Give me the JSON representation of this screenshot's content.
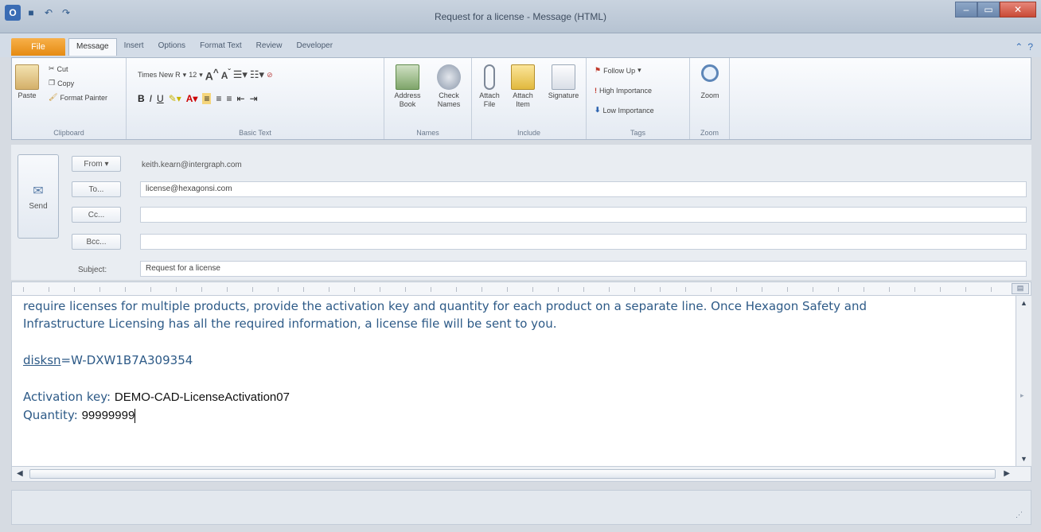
{
  "window": {
    "title": "Request for a license - Message (HTML)",
    "qat": [
      "save-icon",
      "undo-icon",
      "redo-icon"
    ],
    "controls": [
      "–",
      "▭",
      "✕"
    ]
  },
  "ribbon_tabs": {
    "file": "File",
    "tabs": [
      "Message",
      "Insert",
      "Options",
      "Format Text",
      "Review",
      "Developer"
    ],
    "active": "Message"
  },
  "ribbon": {
    "clipboard": {
      "paste": "Paste",
      "cut": "Cut",
      "copy": "Copy",
      "format_painter": "Format Painter",
      "label": "Clipboard"
    },
    "basic_text": {
      "font": "Times New R",
      "size": "12",
      "label": "Basic Text"
    },
    "names": {
      "address_book": "Address Book",
      "check_names": "Check Names",
      "label": "Names"
    },
    "include": {
      "attach_file": "Attach File",
      "attach_item": "Attach Item",
      "signature": "Signature",
      "label": "Include"
    },
    "tags": {
      "follow_up": "Follow Up",
      "high_importance": "High Importance",
      "low_importance": "Low Importance",
      "label": "Tags"
    },
    "zoom": {
      "zoom": "Zoom",
      "label": "Zoom"
    }
  },
  "header": {
    "send": "Send",
    "from_button": "From ▾",
    "from_value": "keith.kearn@intergraph.com",
    "to_button": "To...",
    "to_value": "license@hexagonsi.com",
    "cc_button": "Cc...",
    "cc_value": "",
    "bcc_button": "Bcc...",
    "bcc_value": "",
    "subject_label": "Subject:",
    "subject_value": "Request for a license"
  },
  "body": {
    "line1": "require licenses for multiple products, provide the activation key and quantity for each product on a separate line.  Once Hexagon Safety and",
    "line2": "Infrastructure Licensing has all the required information, a license file will be sent to you.",
    "disksn_key": "disksn",
    "disksn_value": "=W-DXW1B7A309354",
    "activation_label": "Activation key: ",
    "activation_value": "DEMO-CAD-LicenseActivation07",
    "quantity_label": "Quantity: ",
    "quantity_value": "99999999"
  },
  "colors": {
    "accent": "#e58b12",
    "body_text": "#2d5a87"
  }
}
